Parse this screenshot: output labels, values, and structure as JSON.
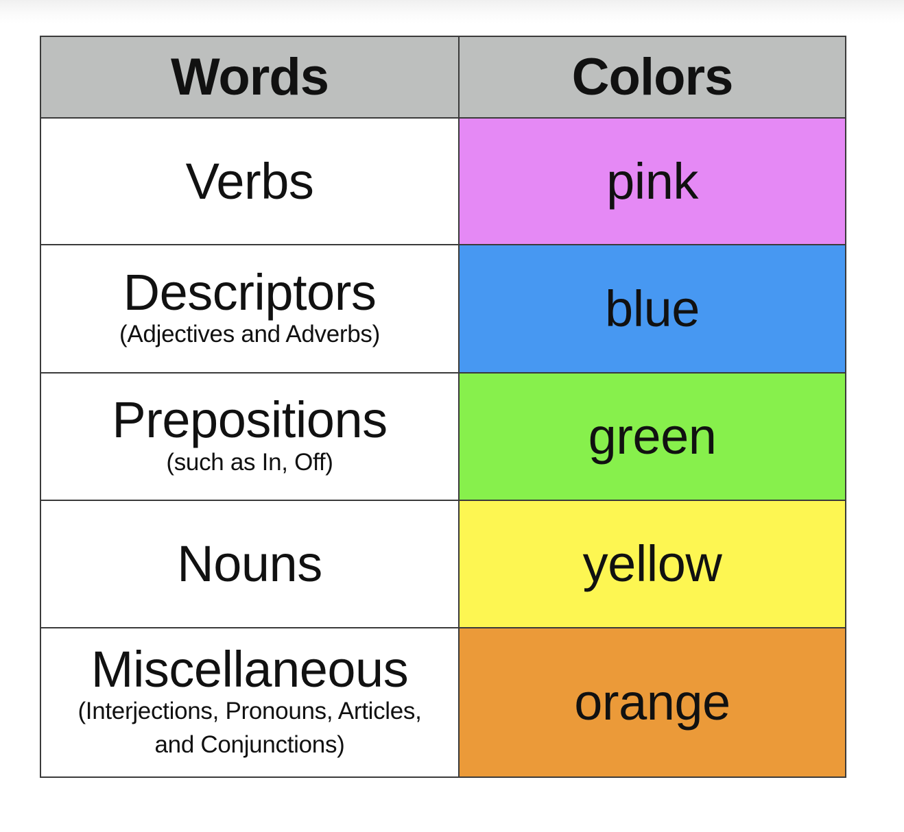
{
  "table": {
    "header": {
      "words": "Words",
      "colors": "Colors"
    },
    "rows": [
      {
        "word": "Verbs",
        "note": "",
        "color_name": "pink",
        "color_hex": "#e589f5"
      },
      {
        "word": "Descriptors",
        "note": "(Adjectives and Adverbs)",
        "color_name": "blue",
        "color_hex": "#4798f2"
      },
      {
        "word": "Prepositions",
        "note": "(such as In, Off)",
        "color_name": "green",
        "color_hex": "#87f04c"
      },
      {
        "word": "Nouns",
        "note": "",
        "color_name": "yellow",
        "color_hex": "#fdf652"
      },
      {
        "word": "Miscellaneous",
        "note_lines": [
          "(Interjections, Pronouns, Articles,",
          "and Conjunctions)"
        ],
        "color_name": "orange",
        "color_hex": "#eb9a39"
      }
    ],
    "header_bg": "#bdbfbe",
    "border_color": "#3a3a3a"
  }
}
